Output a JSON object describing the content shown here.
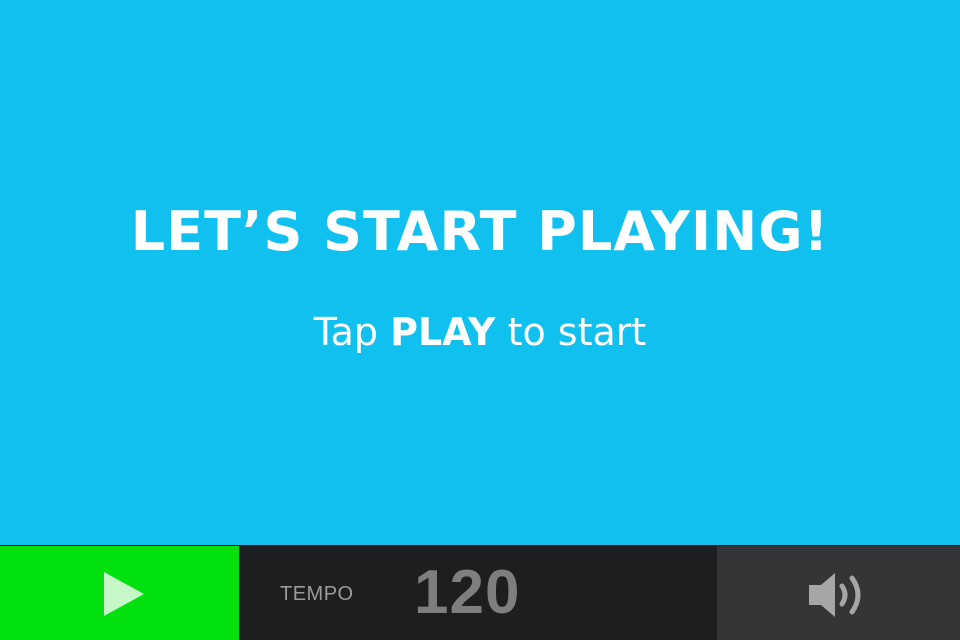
{
  "main": {
    "headline": "LET’S START PLAYING!",
    "instruction": {
      "prefix": "Tap ",
      "emphasis": "PLAY",
      "suffix": " to start"
    }
  },
  "toolbar": {
    "play_icon": "play-icon",
    "tempo_label": "TEMPO",
    "tempo_value": "120",
    "volume_icon": "speaker-volume-icon"
  },
  "colors": {
    "background": "#10c0ee",
    "play_button": "#00e10e",
    "toolbar": "#1d1e20",
    "volume_button": "#333537"
  }
}
